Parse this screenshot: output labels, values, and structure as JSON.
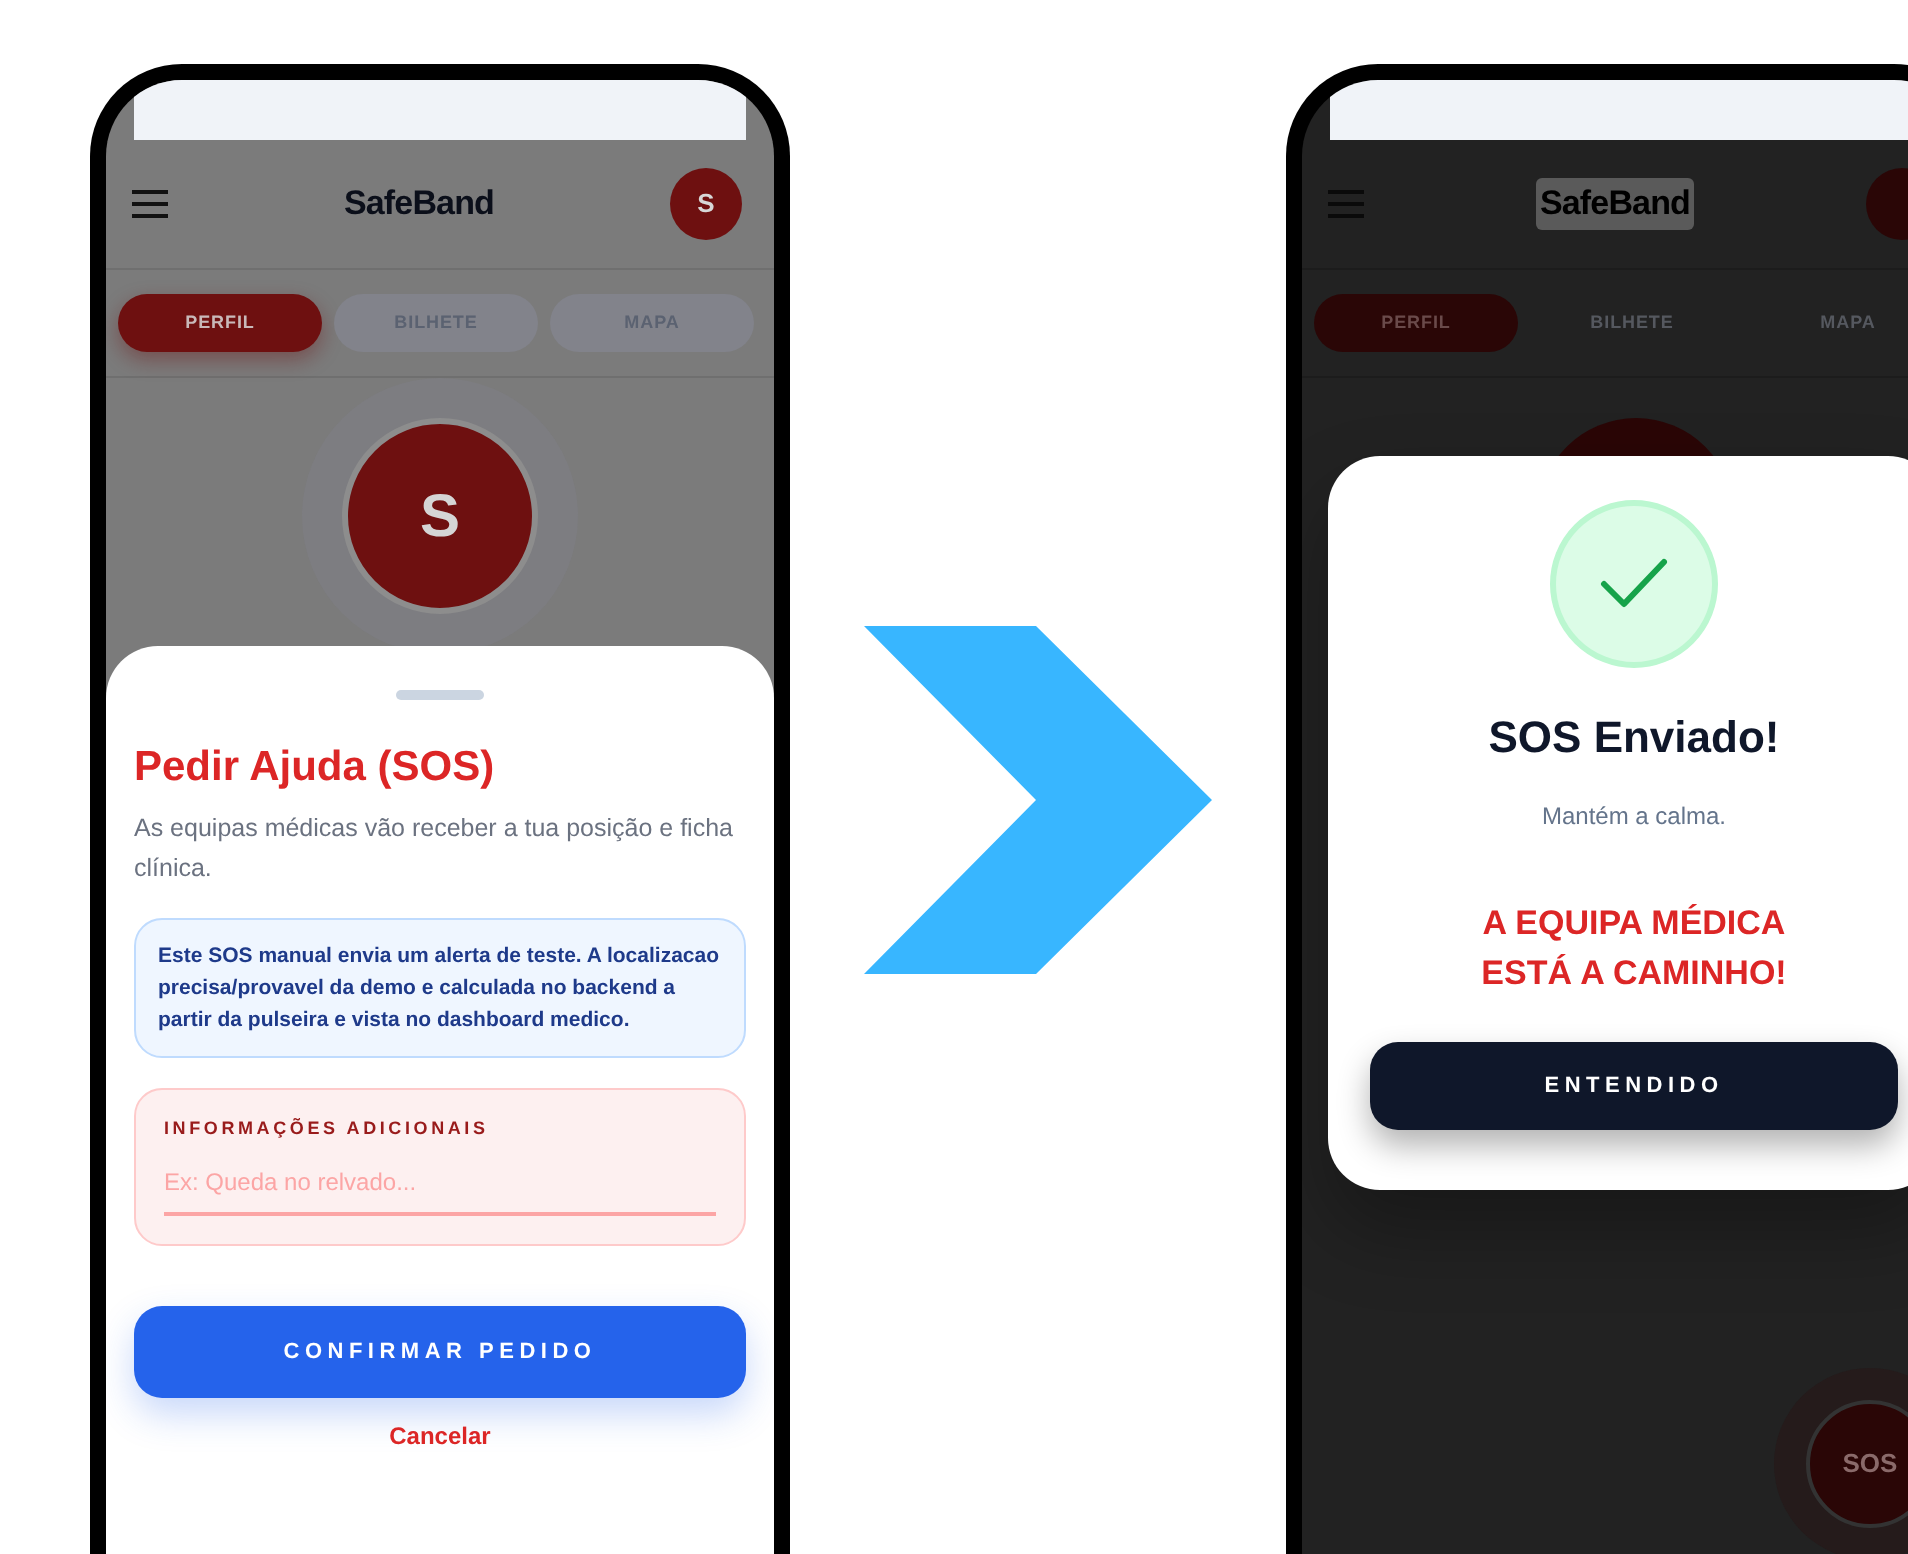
{
  "phones": [
    {
      "kind": "sos_form",
      "header": {
        "title": "SafeBand",
        "avatar": "S"
      },
      "tabs": [
        {
          "label": "PERFIL",
          "selected": true
        },
        {
          "label": "BILHETE",
          "selected": false
        },
        {
          "label": "MAPA",
          "selected": false
        }
      ],
      "profile_avatar": "S",
      "sheet": {
        "title": "Pedir Ajuda (SOS)",
        "subtitle": "As equipas médicas vão receber a tua posição e ficha clínica.",
        "notice": "Este SOS manual envia um alerta de teste. A localizacao precisa/provavel da demo e calculada no backend a partir da pulseira e vista no dashboard medico.",
        "field": {
          "label": "INFORMAÇÕES ADICIONAIS",
          "placeholder": "Ex: Queda no relvado..."
        },
        "confirm_button": "CONFIRMAR PEDIDO",
        "cancel_link": "Cancelar"
      }
    },
    {
      "kind": "confirmation",
      "header": {
        "title": "SafeBand"
      },
      "tabs": [
        {
          "label": "PERFIL",
          "selected": true
        },
        {
          "label": "BILHETE",
          "selected": false
        },
        {
          "label": "MAPA",
          "selected": false
        }
      ],
      "dialog": {
        "title": "SOS Enviado!",
        "message": "Mantém a calma.",
        "alert": "A EQUIPA MÉDICA ESTÁ A CAMINHO!",
        "button": "ENTENDIDO"
      },
      "sos_button": "SOS"
    }
  ]
}
